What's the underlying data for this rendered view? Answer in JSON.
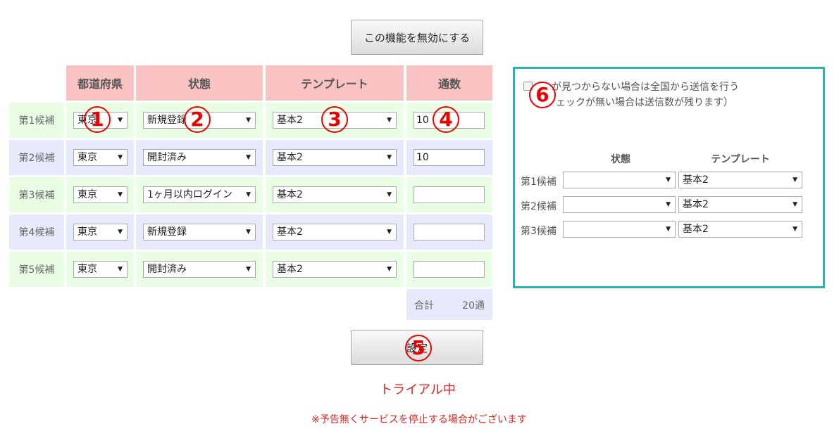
{
  "top_button": "この機能を無効にする",
  "table": {
    "headers": [
      "都道府県",
      "状態",
      "テンプレート",
      "通数"
    ],
    "rows": [
      {
        "label": "第1候補",
        "pref": "東京",
        "state": "新規登録",
        "template": "基本2",
        "count": "10"
      },
      {
        "label": "第2候補",
        "pref": "東京",
        "state": "開封済み",
        "template": "基本2",
        "count": "10"
      },
      {
        "label": "第3候補",
        "pref": "東京",
        "state": "1ヶ月以内ログイン",
        "template": "基本2",
        "count": ""
      },
      {
        "label": "第4候補",
        "pref": "東京",
        "state": "新規登録",
        "template": "基本2",
        "count": ""
      },
      {
        "label": "第5候補",
        "pref": "東京",
        "state": "開封済み",
        "template": "基本2",
        "count": ""
      }
    ],
    "total_label": "合計",
    "total_value": "20通"
  },
  "submit_button": "設定",
  "trial_status": "トライアル中",
  "notice": "※予告無くサービスを停止する場合がございます",
  "markers": [
    "1",
    "2",
    "3",
    "4",
    "5",
    "6"
  ],
  "panel": {
    "checkbox_label_line1": "が見つからない場合は全国から送信を行う",
    "checkbox_label_line2": "ェックが無い場合は送信数が残ります）",
    "headers": [
      "状態",
      "テンプレート"
    ],
    "rows": [
      {
        "label": "第1候補",
        "state": "",
        "template": "基本2"
      },
      {
        "label": "第2候補",
        "state": "",
        "template": "基本2"
      },
      {
        "label": "第3候補",
        "state": "",
        "template": "基本2"
      }
    ]
  },
  "colors": {
    "header_bg": "#f9c3c3",
    "row_green": "#eafde5",
    "row_blue": "#e7eafb",
    "panel_border": "#2bb3b1",
    "accent_red": "#dd2222"
  },
  "icons": {
    "dropdown": "chevron-down-icon"
  }
}
